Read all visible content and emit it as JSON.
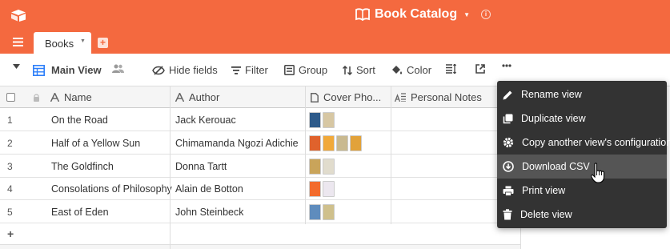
{
  "header": {
    "base_name": "Book Catalog",
    "icons": [
      "airtable-logo-icon",
      "book-icon",
      "chevron-down-icon",
      "info-icon"
    ]
  },
  "tabs": {
    "active": "Books",
    "add_icon": "plus-icon"
  },
  "toolbar": {
    "view_name": "Main View",
    "hide_fields": "Hide fields",
    "filter": "Filter",
    "group": "Group",
    "sort": "Sort",
    "color": "Color"
  },
  "columns": [
    "Name",
    "Author",
    "Cover Pho...",
    "Personal Notes"
  ],
  "rows": [
    {
      "num": "1",
      "name": "On the Road",
      "author": "Jack Kerouac",
      "covers": [
        "#2d5a8a",
        "#d7c7a3"
      ]
    },
    {
      "num": "2",
      "name": "Half of a Yellow Sun",
      "author": "Chimamanda Ngozi Adichie",
      "covers": [
        "#e0622c",
        "#f1a93a",
        "#c9b98f",
        "#e2a23a"
      ]
    },
    {
      "num": "3",
      "name": "The Goldfinch",
      "author": "Donna Tartt",
      "covers": [
        "#c9a45a",
        "#e1dccd"
      ]
    },
    {
      "num": "4",
      "name": "Consolations of Philosophy",
      "author": "Alain de Botton",
      "covers": [
        "#f36b2c",
        "#ece7ef"
      ]
    },
    {
      "num": "5",
      "name": "East of Eden",
      "author": "John Steinbeck",
      "covers": [
        "#5f8cbd",
        "#cfc08c"
      ]
    }
  ],
  "context_menu": [
    {
      "label": "Rename view",
      "icon": "pencil-icon"
    },
    {
      "label": "Duplicate view",
      "icon": "duplicate-icon"
    },
    {
      "label": "Copy another view's configuration",
      "icon": "gear-icon"
    },
    {
      "label": "Download CSV",
      "icon": "download-icon"
    },
    {
      "label": "Print view",
      "icon": "printer-icon"
    },
    {
      "label": "Delete view",
      "icon": "trash-icon"
    }
  ],
  "colors": {
    "brand": "#f4693f",
    "menu_bg": "#333333",
    "menu_hover": "#555555",
    "grid_view": "#2d7ff9"
  }
}
